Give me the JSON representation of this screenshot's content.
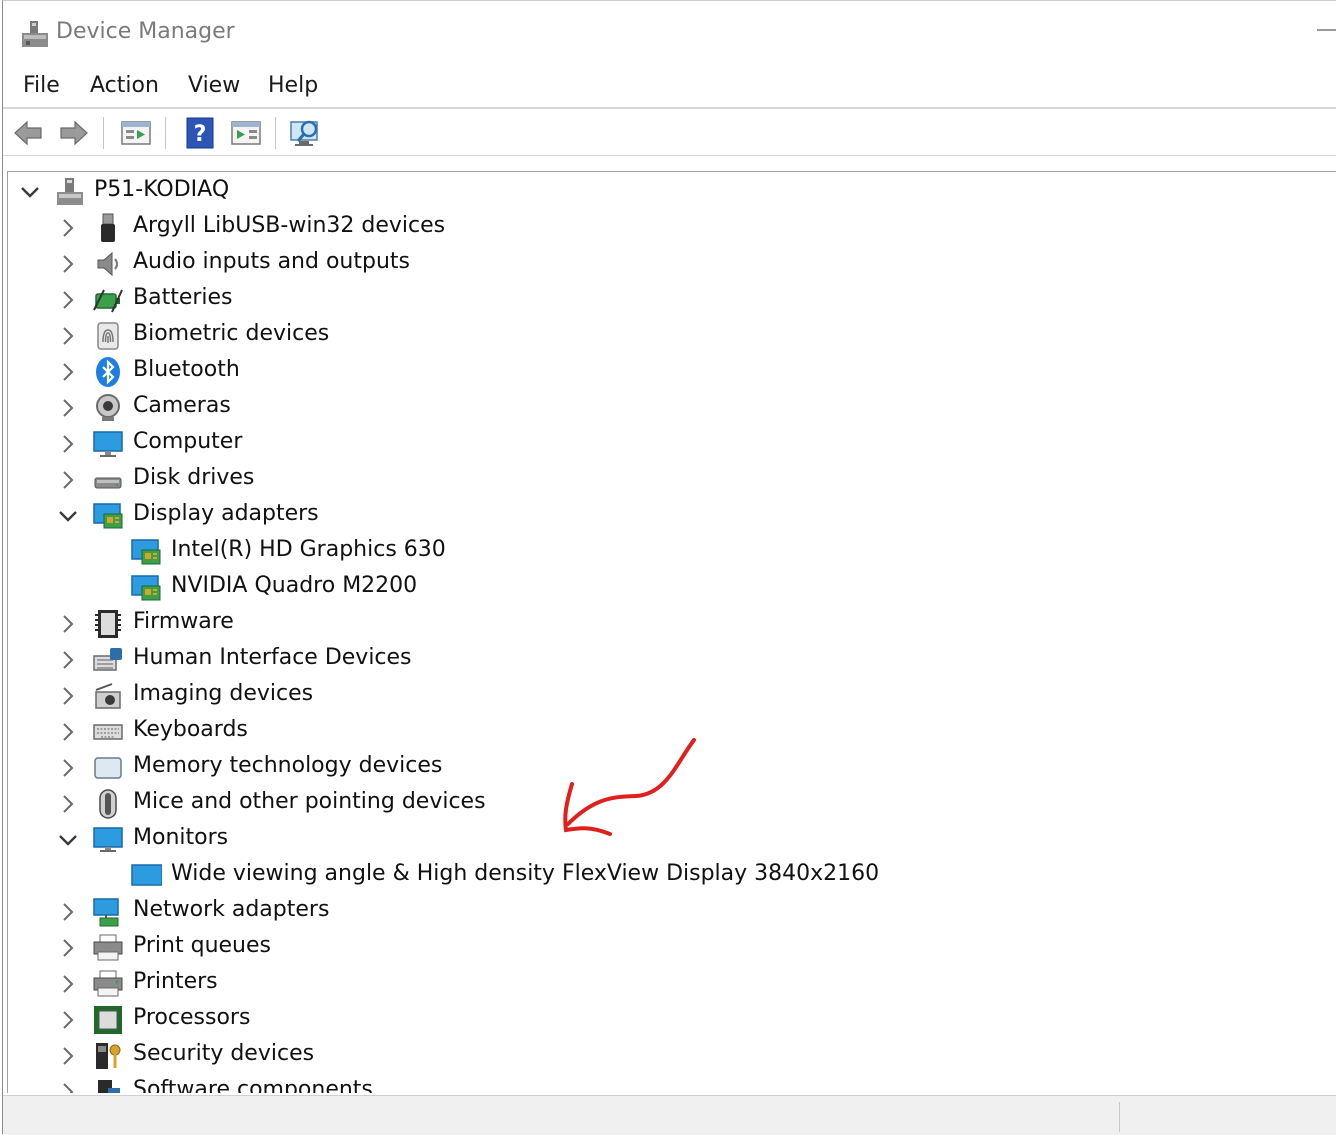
{
  "window": {
    "title": "Device Manager"
  },
  "menu": {
    "file": "File",
    "action": "Action",
    "view": "View",
    "help": "Help"
  },
  "toolbar": {
    "buttons": [
      "back-icon",
      "forward-icon",
      "properties-icon",
      "help-icon",
      "update-driver-icon",
      "scan-hardware-icon"
    ]
  },
  "tree": {
    "root": {
      "label": "P51-KODIAQ",
      "expanded": true
    },
    "categories": [
      {
        "label": "Argyll LibUSB-win32 devices",
        "icon": "usb-icon",
        "expanded": false
      },
      {
        "label": "Audio inputs and outputs",
        "icon": "speaker-icon",
        "expanded": false
      },
      {
        "label": "Batteries",
        "icon": "battery-icon",
        "expanded": false
      },
      {
        "label": "Biometric devices",
        "icon": "fingerprint-icon",
        "expanded": false
      },
      {
        "label": "Bluetooth",
        "icon": "bluetooth-icon",
        "expanded": false
      },
      {
        "label": "Cameras",
        "icon": "camera-icon",
        "expanded": false
      },
      {
        "label": "Computer",
        "icon": "computer-icon",
        "expanded": false
      },
      {
        "label": "Disk drives",
        "icon": "disk-drive-icon",
        "expanded": false
      },
      {
        "label": "Display adapters",
        "icon": "display-adapter-icon",
        "expanded": true,
        "children": [
          {
            "label": "Intel(R) HD Graphics 630"
          },
          {
            "label": "NVIDIA Quadro M2200"
          }
        ]
      },
      {
        "label": "Firmware",
        "icon": "firmware-icon",
        "expanded": false
      },
      {
        "label": "Human Interface Devices",
        "icon": "hid-icon",
        "expanded": false
      },
      {
        "label": "Imaging devices",
        "icon": "imaging-icon",
        "expanded": false
      },
      {
        "label": "Keyboards",
        "icon": "keyboard-icon",
        "expanded": false
      },
      {
        "label": "Memory technology devices",
        "icon": "memory-icon",
        "expanded": false
      },
      {
        "label": "Mice and other pointing devices",
        "icon": "mouse-icon",
        "expanded": false
      },
      {
        "label": "Monitors",
        "icon": "monitor-icon",
        "expanded": true,
        "children": [
          {
            "label": "Wide viewing angle & High density FlexView Display 3840x2160"
          }
        ]
      },
      {
        "label": "Network adapters",
        "icon": "network-icon",
        "expanded": false
      },
      {
        "label": "Print queues",
        "icon": "print-queue-icon",
        "expanded": false
      },
      {
        "label": "Printers",
        "icon": "printer-icon",
        "expanded": false
      },
      {
        "label": "Processors",
        "icon": "processor-icon",
        "expanded": false
      },
      {
        "label": "Security devices",
        "icon": "security-icon",
        "expanded": false
      },
      {
        "label": "Software components",
        "icon": "software-icon",
        "expanded": false
      }
    ]
  },
  "colors": {
    "annotation": "#e0201c",
    "monitor_blue": "#2d9be0",
    "bluetooth_blue": "#1e7fe0"
  }
}
